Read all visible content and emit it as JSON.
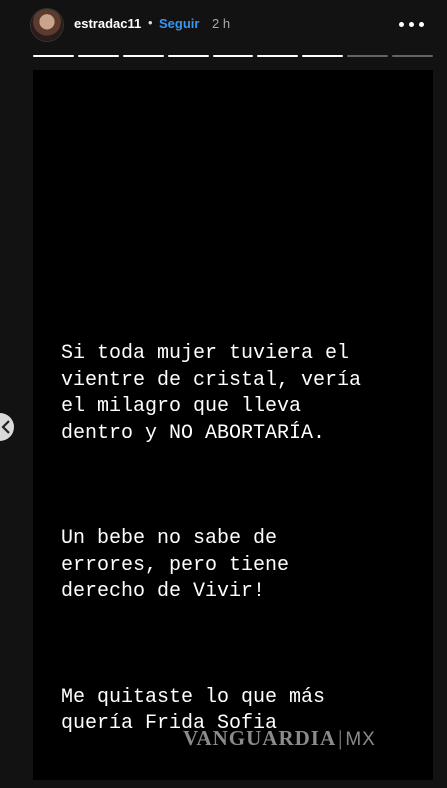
{
  "header": {
    "username": "estradac11",
    "separator": "•",
    "follow_label": "Seguir",
    "time": "2 h"
  },
  "progress": {
    "total_segments": 9,
    "completed_segments": 7
  },
  "story": {
    "paragraphs": [
      "Si toda mujer tuviera el\nvientre de cristal, vería\nel milagro que lleva\ndentro y NO ABORTARÍA.",
      "Un bebe no sabe de\nerrores, pero tiene\nderecho de Vivir!",
      "Me quitaste lo que más\nquería Frida Sofia"
    ]
  },
  "watermark": {
    "brand": "VANGUARDIA",
    "divider": "|",
    "region": "MX"
  },
  "icons": {
    "avatar": "profile-avatar",
    "more": "more-horizontal-icon",
    "prev": "chevron-left-icon"
  },
  "colors": {
    "follow": "#3897f0",
    "background": "#121212",
    "story": "#000000"
  }
}
